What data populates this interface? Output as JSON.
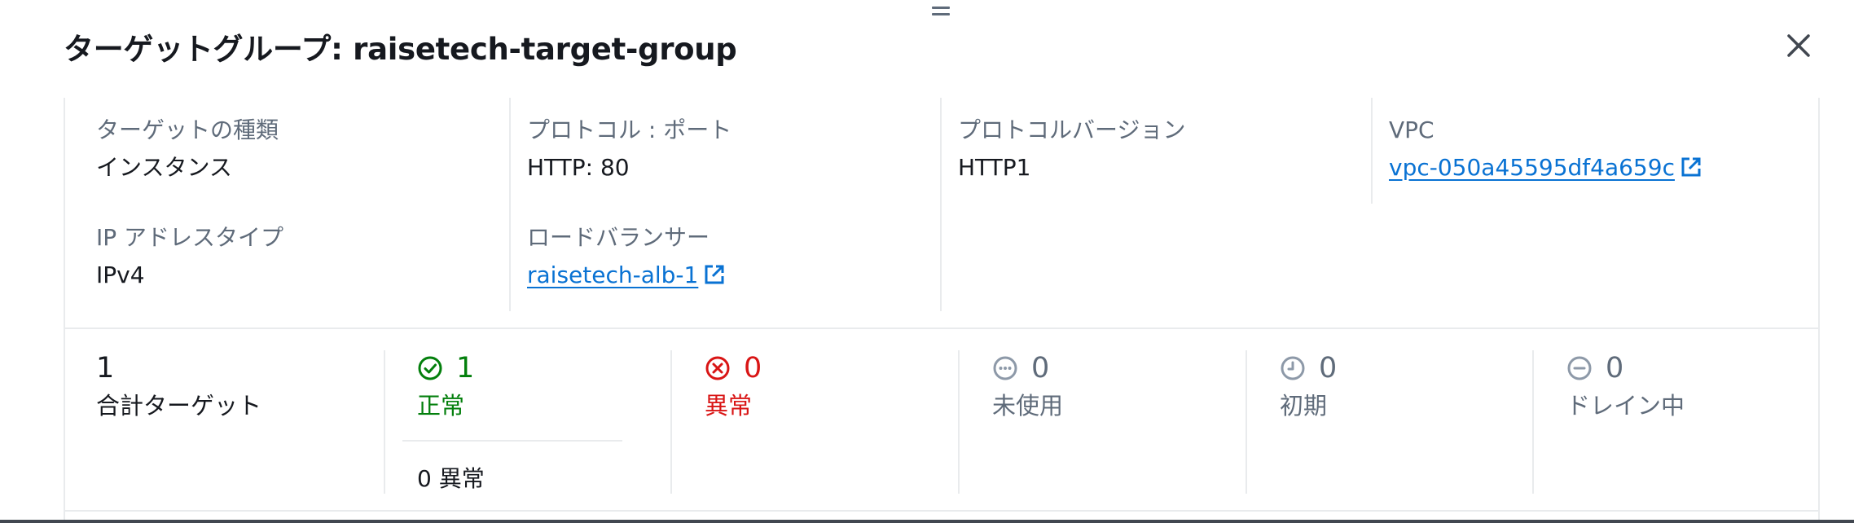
{
  "header": {
    "title": "ターゲットグループ: raisetech-target-group"
  },
  "details": {
    "target_type": {
      "label": "ターゲットの種類",
      "value": "インスタンス"
    },
    "ip_address_type": {
      "label": "IP アドレスタイプ",
      "value": "IPv4"
    },
    "protocol_port": {
      "label": "プロトコル : ポート",
      "value": "HTTP: 80"
    },
    "load_balancer": {
      "label": "ロードバランサー",
      "value": "raisetech-alb-1"
    },
    "protocol_version": {
      "label": "プロトコルバージョン",
      "value": "HTTP1"
    },
    "vpc": {
      "label": "VPC",
      "value": "vpc-050a45595df4a659c"
    }
  },
  "stats": {
    "total": {
      "value": "1",
      "label": "合計ターゲット"
    },
    "healthy": {
      "value": "1",
      "label": "正常",
      "note": "0 異常",
      "icon": "check-circle-icon"
    },
    "unhealthy": {
      "value": "0",
      "label": "異常",
      "icon": "x-circle-icon"
    },
    "unused": {
      "value": "0",
      "label": "未使用",
      "icon": "ellipsis-circle-icon"
    },
    "initial": {
      "value": "0",
      "label": "初期",
      "icon": "clock-icon"
    },
    "draining": {
      "value": "0",
      "label": "ドレイン中",
      "icon": "minus-circle-icon"
    }
  },
  "colors": {
    "link": "#0972d3",
    "healthy": "#037f0c",
    "unhealthy": "#d91515",
    "neutral": "#5f6b7a",
    "text": "#16191f"
  }
}
